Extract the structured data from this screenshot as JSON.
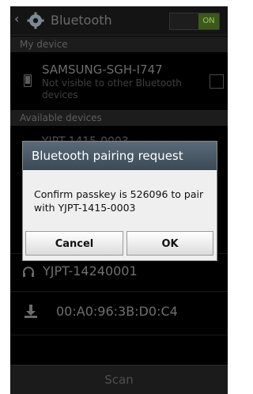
{
  "action_bar": {
    "title": "Bluetooth",
    "toggle_label": "ON"
  },
  "my_device": {
    "header": "My device",
    "name": "SAMSUNG-SGH-I747",
    "status": "Not visible to other Bluetooth devices"
  },
  "available": {
    "header": "Available devices",
    "partial_device_name": "YJPT-1415-0003"
  },
  "devices": [
    {
      "name": "YJPT-14240001",
      "icon": "headphones-icon"
    },
    {
      "name": "00:A0:96:3B:D0:C4",
      "icon": "download-icon"
    }
  ],
  "dialog": {
    "title": "Bluetooth pairing request",
    "message": "Confirm passkey is 526096 to pair with YJPT-1415-0003",
    "cancel_label": "Cancel",
    "ok_label": "OK"
  },
  "footer": {
    "scan_label": "Scan"
  },
  "colors": {
    "toggle_on": "#3b5a1a",
    "dialog_header": "#4a5a68"
  }
}
